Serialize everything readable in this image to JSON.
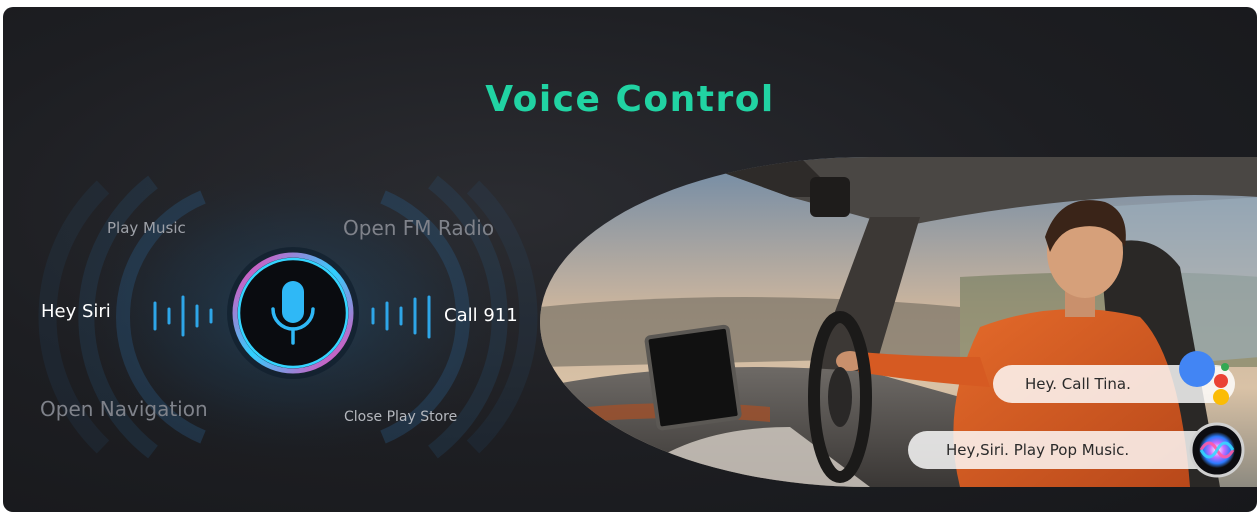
{
  "header": {
    "title": "Voice Control"
  },
  "voice_commands": {
    "play_music": "Play Music",
    "open_fm_radio": "Open FM Radio",
    "hey_siri": "Hey Siri",
    "call_911": "Call 911",
    "open_navigation": "Open Navigation",
    "close_play_store": "Close Play Store"
  },
  "speech_bubbles": {
    "google_assistant": "Hey. Call Tina.",
    "siri": "Hey,Siri. Play Pop Music."
  },
  "icons": {
    "microphone": "microphone-icon",
    "google_assistant": "google-assistant-icon",
    "siri": "siri-icon"
  },
  "colors": {
    "title_accent": "#21d3a3",
    "mic_blue": "#2fb8f6",
    "waveform_blue": "#2ea6e8",
    "background": "#1d1e22"
  }
}
